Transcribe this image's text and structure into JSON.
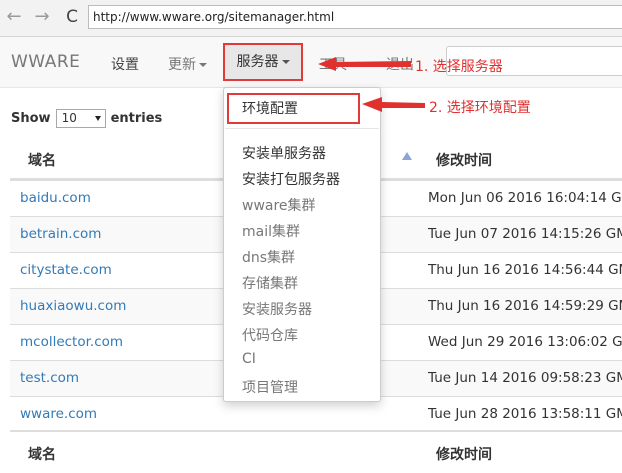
{
  "browser": {
    "url": "http://www.wware.org/sitemanager.html",
    "back_icon": "←",
    "forward_icon": "→",
    "reload_icon": "C"
  },
  "navbar": {
    "brand": "WWARE",
    "settings": "设置",
    "update": "更新",
    "server": "服务器",
    "tools": "工具",
    "logout": "退出"
  },
  "annotations": {
    "step1": "1. 选择服务器",
    "step2": "2. 选择环境配置",
    "color": "#e0312f"
  },
  "dropdown": {
    "items": [
      "环境配置",
      "安装单服务器",
      "安装打包服务器",
      "wware集群",
      "mail集群",
      "dns集群",
      "存储集群",
      "安装服务器",
      "代码仓库",
      "CI",
      "项目管理"
    ]
  },
  "entries": {
    "show_label": "Show",
    "value": "10",
    "suffix": "entries"
  },
  "table": {
    "headers": {
      "domain": "域名",
      "modified": "修改时间"
    },
    "rows": [
      {
        "domain": "baidu.com",
        "modified": "Mon Jun 06 2016 16:04:14 GM"
      },
      {
        "domain": "betrain.com",
        "modified": "Tue Jun 07 2016 14:15:26 GM"
      },
      {
        "domain": "citystate.com",
        "modified": "Thu Jun 16 2016 14:56:44 GM"
      },
      {
        "domain": "huaxiaowu.com",
        "modified": "Thu Jun 16 2016 14:59:29 GM"
      },
      {
        "domain": "mcollector.com",
        "modified": "Wed Jun 29 2016 13:06:02 GM"
      },
      {
        "domain": "test.com",
        "modified": "Tue Jun 14 2016 09:58:23 GM"
      },
      {
        "domain": "wware.com",
        "modified": "Tue Jun 28 2016 13:58:11 GM"
      }
    ],
    "footer": {
      "domain": "域名",
      "modified": "修改时间"
    }
  }
}
